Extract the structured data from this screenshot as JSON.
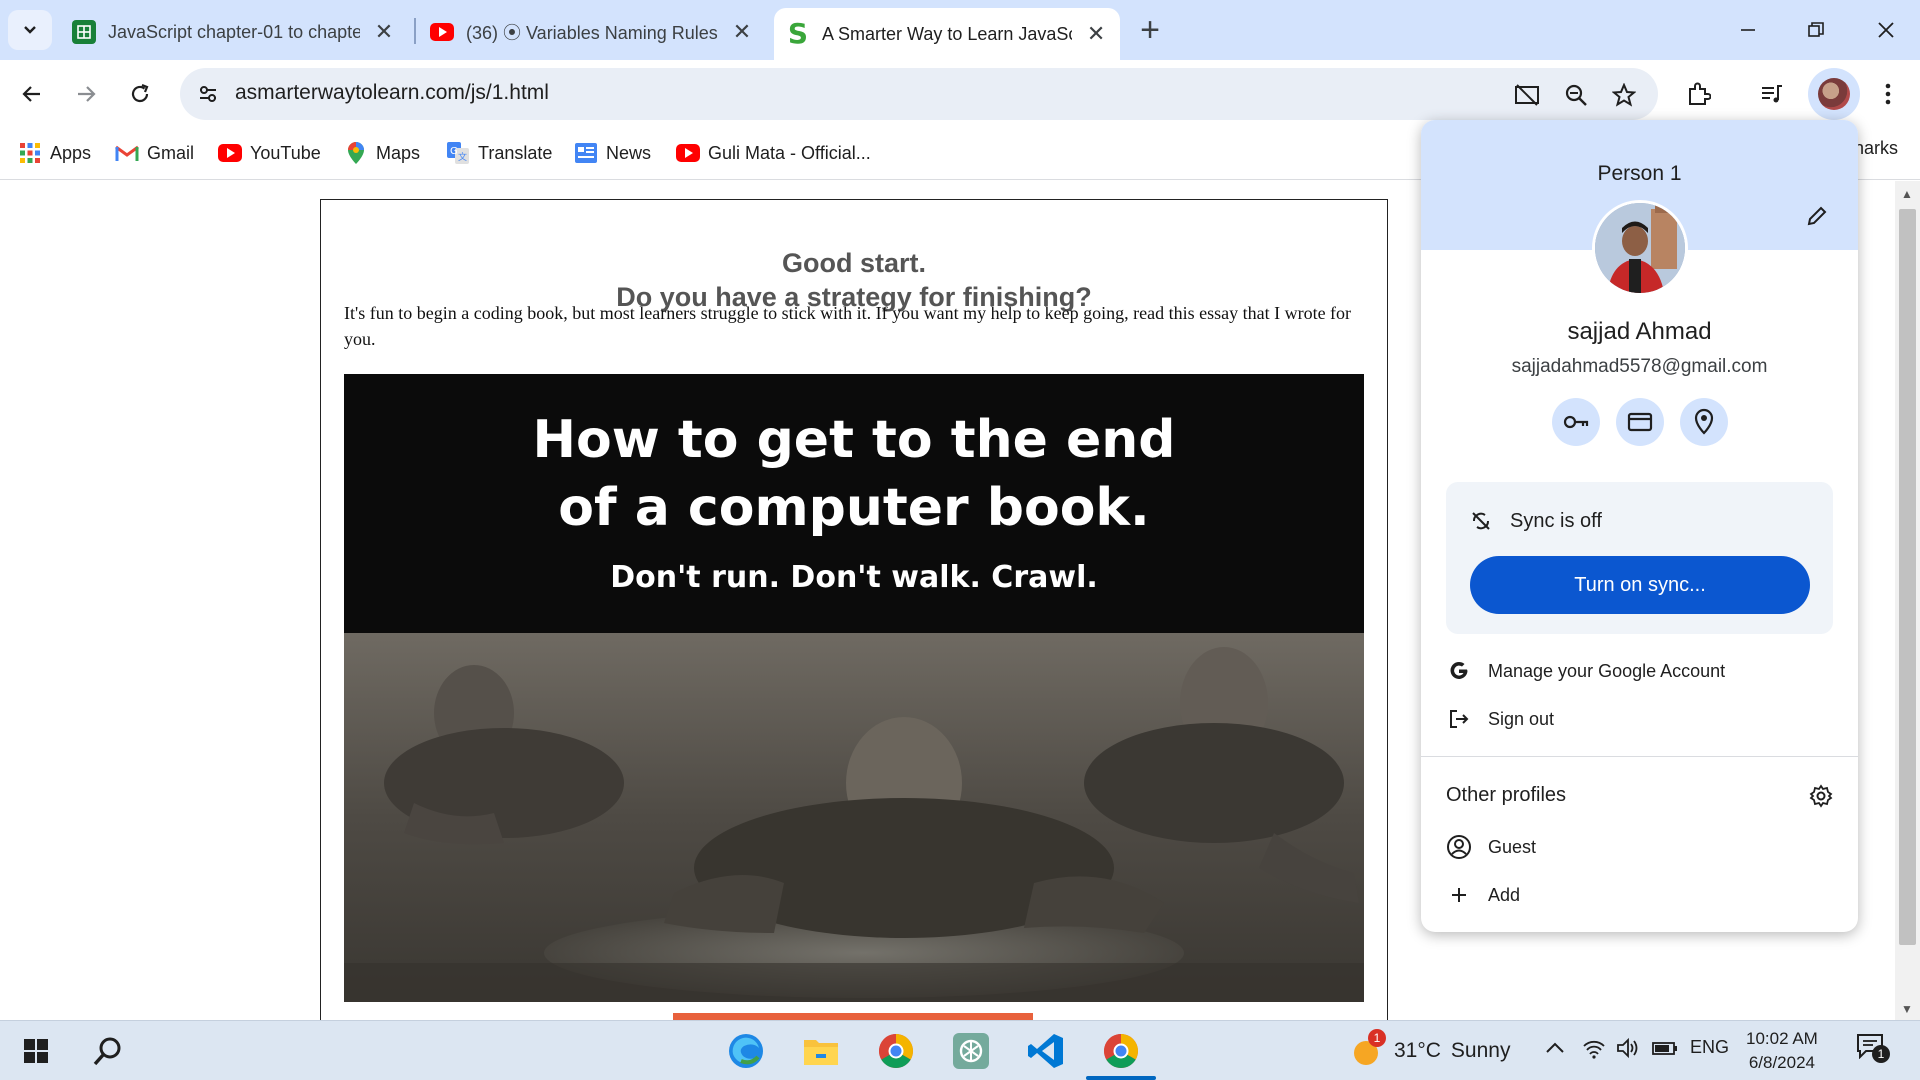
{
  "tabs": [
    {
      "title": "JavaScript chapter-01 to chapte",
      "favicon": "sheets-icon",
      "active": false
    },
    {
      "title": "(36) ⦿ Variables Naming Rules",
      "favicon": "youtube-icon",
      "active": false
    },
    {
      "title": "A Smarter Way to Learn JavaScr",
      "favicon": "s-icon",
      "active": true
    }
  ],
  "address_bar": {
    "url": "asmarterwaytolearn.com/js/1.html"
  },
  "bookmarks": [
    {
      "label": "Apps",
      "icon": "apps-grid-icon"
    },
    {
      "label": "Gmail",
      "icon": "gmail-icon"
    },
    {
      "label": "YouTube",
      "icon": "youtube-icon"
    },
    {
      "label": "Maps",
      "icon": "maps-pin-icon"
    },
    {
      "label": "Translate",
      "icon": "translate-icon"
    },
    {
      "label": "News",
      "icon": "news-icon"
    },
    {
      "label": "Guli Mata - Official...",
      "icon": "youtube-icon"
    }
  ],
  "bookmarks_right": "harks",
  "page": {
    "heading_line1": "Good start.",
    "heading_line2": "Do you have a strategy for finishing?",
    "body": "It's fun to begin a coding book, but most learners struggle to stick with it. If you want my help to keep going, read this essay that I wrote for you.",
    "hero_line1": "How to get to the end",
    "hero_line2": "of a computer book.",
    "hero_line3": "Don't run. Don't walk. Crawl."
  },
  "profile_menu": {
    "profile_name": "Person 1",
    "user_name": "sajjad Ahmad",
    "email": "sajjadahmad5578@gmail.com",
    "quick_actions": [
      "passwords-key-icon",
      "payment-card-icon",
      "address-pin-icon"
    ],
    "sync_status": "Sync is off",
    "sync_button": "Turn on sync...",
    "manage_account": "Manage your Google Account",
    "sign_out": "Sign out",
    "other_profiles_title": "Other profiles",
    "guest": "Guest",
    "add": "Add"
  },
  "taskbar": {
    "weather_temp": "31°C",
    "weather_desc": "Sunny",
    "weather_badge": "1",
    "language": "ENG",
    "time": "10:02 AM",
    "date": "6/8/2024",
    "notification_count": "1"
  },
  "colors": {
    "tabstrip_bg": "#d3e3fd",
    "sync_button": "#0b57d0",
    "accent_orange": "#e8613c"
  }
}
